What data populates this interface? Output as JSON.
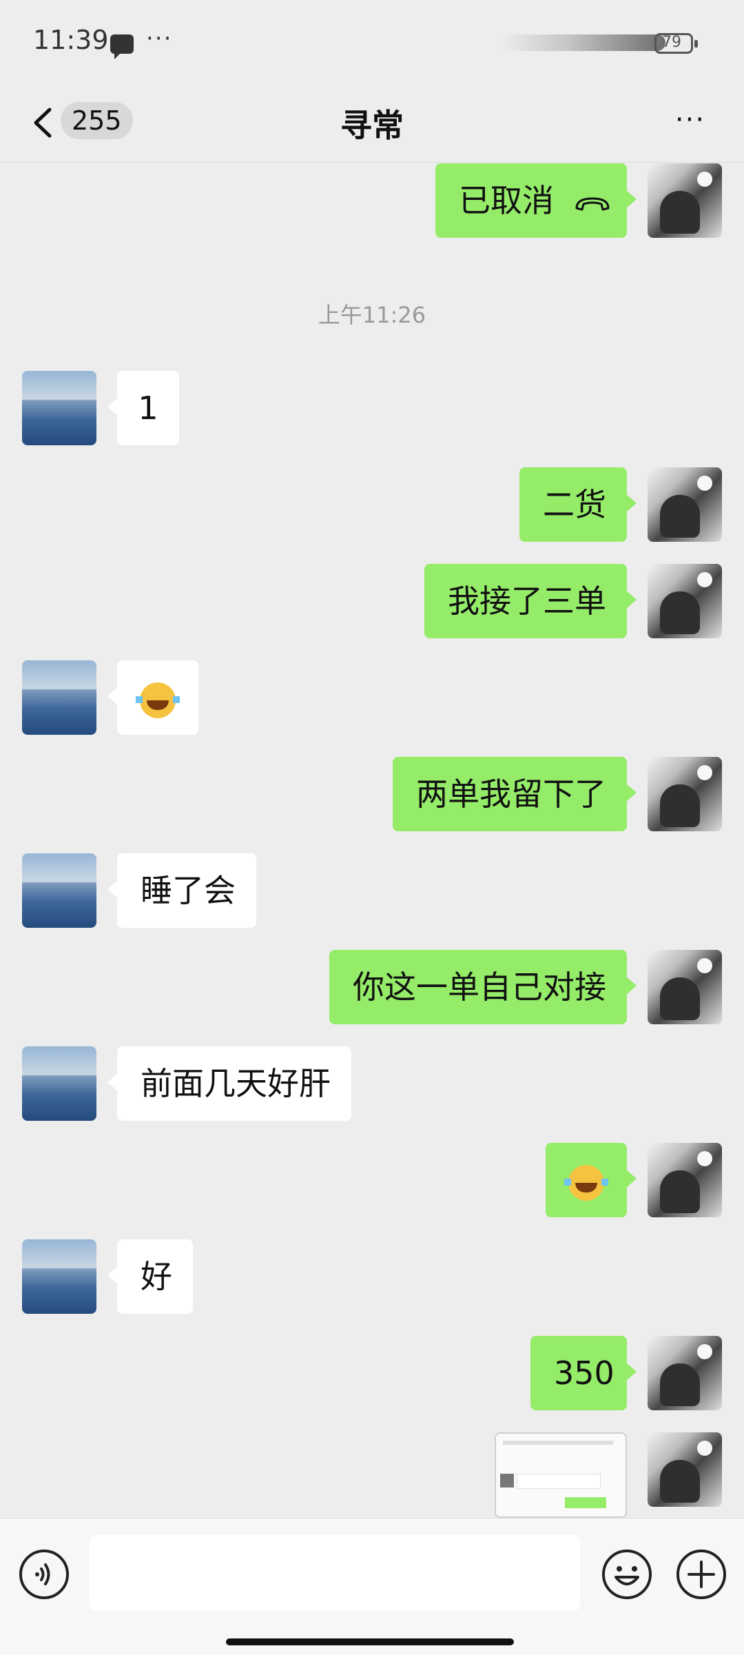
{
  "status_bar": {
    "time": "11:39",
    "dots": "···",
    "battery": "79"
  },
  "header": {
    "back_count": "255",
    "title": "寻常",
    "more": "···"
  },
  "messages": [
    {
      "side": "me",
      "type": "call",
      "text": "已取消",
      "icon": "hangup-phone-icon"
    },
    {
      "type": "time",
      "text": "上午11:26"
    },
    {
      "side": "other",
      "type": "text",
      "text": "1"
    },
    {
      "side": "me",
      "type": "text",
      "text": "二货"
    },
    {
      "side": "me",
      "type": "text",
      "text": "我接了三单"
    },
    {
      "side": "other",
      "type": "emoji",
      "icon": "laugh-cry-emoji"
    },
    {
      "side": "me",
      "type": "text",
      "text": "两单我留下了"
    },
    {
      "side": "other",
      "type": "text",
      "text": "睡了会"
    },
    {
      "side": "me",
      "type": "text",
      "text": "你这一单自己对接"
    },
    {
      "side": "other",
      "type": "text",
      "text": "前面几天好肝"
    },
    {
      "side": "me",
      "type": "emoji",
      "icon": "laugh-cry-emoji"
    },
    {
      "side": "other",
      "type": "text",
      "text": "好"
    },
    {
      "side": "me",
      "type": "text",
      "text": "350"
    },
    {
      "side": "me",
      "type": "image",
      "icon": "screenshot-thumbnail"
    }
  ],
  "input_bar": {
    "placeholder": "",
    "voice_icon": "voice-icon",
    "emoji_icon": "emoji-icon",
    "plus_icon": "plus-icon"
  },
  "colors": {
    "my_bubble": "#95ec69",
    "other_bubble": "#ffffff",
    "background": "#ededed"
  }
}
